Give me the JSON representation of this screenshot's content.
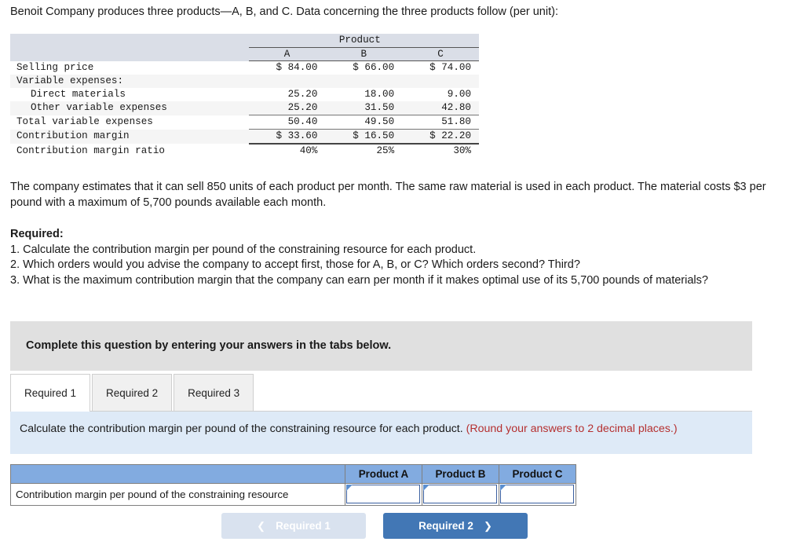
{
  "intro": "Benoit Company produces three products—A, B, and C. Data concerning the three products follow (per unit):",
  "data_table": {
    "group_header": "Product",
    "columns": [
      "A",
      "B",
      "C"
    ],
    "rows": [
      {
        "label": "Selling price",
        "indent": false,
        "values": [
          "$  84.00",
          "$  66.00",
          "$  74.00"
        ]
      },
      {
        "label": "Variable expenses:",
        "indent": false,
        "values": [
          "",
          "",
          ""
        ]
      },
      {
        "label": "Direct materials",
        "indent": true,
        "values": [
          "25.20",
          "18.00",
          "9.00"
        ]
      },
      {
        "label": "Other variable expenses",
        "indent": true,
        "values": [
          "25.20",
          "31.50",
          "42.80"
        ]
      },
      {
        "label": "Total variable expenses",
        "indent": false,
        "values": [
          "50.40",
          "49.50",
          "51.80"
        ]
      },
      {
        "label": "Contribution margin",
        "indent": false,
        "values": [
          "$  33.60",
          "$  16.50",
          "$  22.20"
        ]
      },
      {
        "label": "Contribution margin ratio",
        "indent": false,
        "values": [
          "40%",
          "25%",
          "30%"
        ]
      }
    ]
  },
  "estimate_paragraph": "The company estimates that it can sell 850 units of each product per month. The same raw material is used in each product. The material costs $3 per pound with a maximum of 5,700 pounds available each month.",
  "required": {
    "heading": "Required:",
    "items": [
      "1. Calculate the contribution margin per pound of the constraining resource for each product.",
      "2. Which orders would you advise the company to accept first, those for A, B, or C? Which orders second? Third?",
      "3. What is the maximum contribution margin that the company can earn per month if it makes optimal use of its 5,700 pounds of materials?"
    ]
  },
  "banner": {
    "text": "Complete this question by entering your answers in the tabs below."
  },
  "tabs": [
    {
      "label": "Required 1",
      "active": true
    },
    {
      "label": "Required 2",
      "active": false
    },
    {
      "label": "Required 3",
      "active": false
    }
  ],
  "question_panel": {
    "main": "Calculate the contribution margin per pound of the constraining resource for each product.",
    "note": "(Round your answers to 2 decimal places.)"
  },
  "answer_table": {
    "headers": [
      "",
      "Product A",
      "Product B",
      "Product C"
    ],
    "row_label": "Contribution margin per pound of the constraining resource",
    "values": [
      "",
      "",
      ""
    ]
  },
  "nav": {
    "prev_label": "Required 1",
    "prev_icon": "chevron-left-icon",
    "prev_disabled": true,
    "next_label": "Required 2",
    "next_icon": "chevron-right-icon"
  },
  "colors": {
    "banner_gray": "#e0e0e0",
    "panel_blue": "#deeaf7",
    "table_header_blue": "#82abe0",
    "accent_blue": "#4277b5",
    "disabled_blue": "#d9e2ef",
    "note_red": "#b53030",
    "data_head_band": "#dadee7"
  }
}
